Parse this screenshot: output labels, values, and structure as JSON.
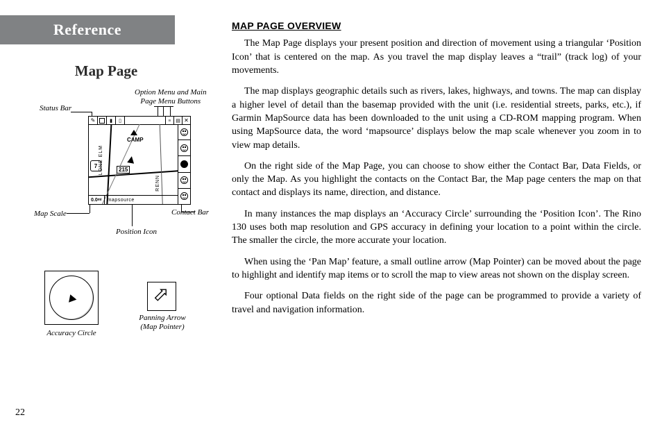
{
  "page_number": "22",
  "tab_title": "Reference",
  "left": {
    "heading": "Map Page",
    "diagram1": {
      "callouts": {
        "status_bar": "Status Bar",
        "option_menu": "Option Menu and Main\nPage Menu Buttons",
        "map_scale": "Map Scale",
        "position_icon": "Position Icon",
        "contact_bar": "Contact Bar"
      },
      "map_labels": {
        "route_shield": "7",
        "camp": "CAMP",
        "bearing_number": "215",
        "street_lone_elm": "LONE ELM",
        "street_renn": "RENN",
        "scale_value": "0.0",
        "mapsource_tag": "mapsource"
      }
    },
    "diagram2": {
      "accuracy_caption": "Accuracy Circle",
      "panning_caption": "Panning Arrow\n(Map Pointer)"
    }
  },
  "right": {
    "section_heading": "MAP PAGE OVERVIEW",
    "paragraphs": [
      "The Map Page displays your present position and direction of movement using a triangular ‘Position Icon’ that is centered on the map.  As you travel the map display leaves a “trail” (track log) of your movements.",
      "The map displays geographic details such as rivers, lakes, highways, and towns.  The map can display a higher level of detail than the basemap provided with the unit (i.e. residential streets, parks, etc.), if Garmin MapSource data has been downloaded to the unit using a CD-ROM mapping program.  When using MapSource data, the word ‘mapsource’ displays below the map scale whenever you zoom in to view map details.",
      "On the right side of the Map Page, you can choose to show either the Contact Bar, Data Fields, or only the Map.  As you highlight the contacts on the Contact Bar, the Map page centers the map on that contact and displays its name, direction, and distance.",
      "In many instances the map displays an ‘Accuracy Circle’ surrounding the ‘Position Icon’.  The Rino 130 uses both map resolution and GPS accuracy in defining your location to a point within the circle.  The smaller the circle, the more accurate your location.",
      "When using the ‘Pan Map’ feature, a small outline arrow (Map Pointer) can be moved about the page to highlight and identify map items or to scroll the map to view areas not shown on the display screen.",
      "Four optional Data fields on the right side of the page can be programmed to provide a variety of travel and navigation information."
    ]
  }
}
